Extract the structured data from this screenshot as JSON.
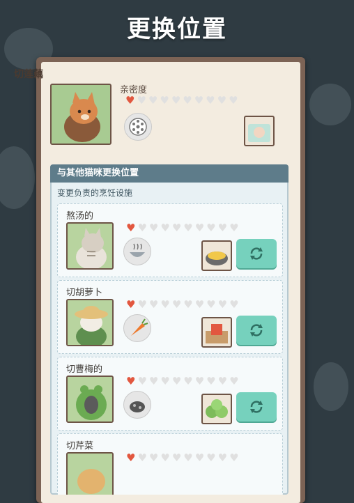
{
  "title": "更换位置",
  "current_cat": {
    "name": "切莲藕",
    "intimacy_label": "亲密度",
    "hearts_filled": 1,
    "hearts_total": 10,
    "skill_icon": "lotus-root-icon",
    "station_icon": "cutting-board-station-icon"
  },
  "swap_section": {
    "header": "与其他猫咪更换位置",
    "subtitle": "变更负责的烹饪设施",
    "cats": [
      {
        "name": "熬汤的",
        "hearts_filled": 1,
        "hearts_total": 10,
        "skill_icon": "soup-bowl-icon",
        "station_icon": "soup-pot-icon"
      },
      {
        "name": "切胡萝卜",
        "hearts_filled": 1,
        "hearts_total": 10,
        "skill_icon": "carrot-icon",
        "station_icon": "carrot-board-icon"
      },
      {
        "name": "切曹梅的",
        "hearts_filled": 1,
        "hearts_total": 10,
        "skill_icon": "pickled-plum-icon",
        "station_icon": "cabbage-icon"
      },
      {
        "name": "切芹菜",
        "hearts_filled": 1,
        "hearts_total": 10,
        "skill_icon": "celery-icon",
        "station_icon": "celery-board-icon"
      }
    ]
  },
  "colors": {
    "accent_swap": "#76d1bd",
    "heart": "#e2573f",
    "panel_border": "#7c6355",
    "header": "#5e7c8a"
  }
}
